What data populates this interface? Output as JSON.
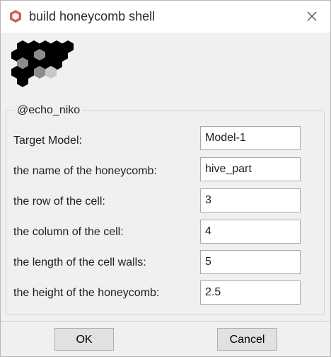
{
  "window": {
    "title": "build honeycomb shell",
    "icon": "honeycomb-app-icon",
    "close_icon": "close-icon"
  },
  "group": {
    "title": "@echo_niko"
  },
  "fields": [
    {
      "label": "Target Model:",
      "value": "Model-1"
    },
    {
      "label": "the name of the honeycomb:",
      "value": "hive_part"
    },
    {
      "label": "the row of the cell:",
      "value": "3"
    },
    {
      "label": "the column of the cell:",
      "value": "4"
    },
    {
      "label": "the length of the cell walls:",
      "value": "5"
    },
    {
      "label": "the height of the honeycomb:",
      "value": "2.5"
    }
  ],
  "buttons": {
    "ok": "OK",
    "cancel": "Cancel"
  },
  "colors": {
    "hex_black": "#000000",
    "hex_gray": "#8c8c8c",
    "hex_light": "#c8c8c8",
    "dialog_bg": "#f0f0f0"
  }
}
